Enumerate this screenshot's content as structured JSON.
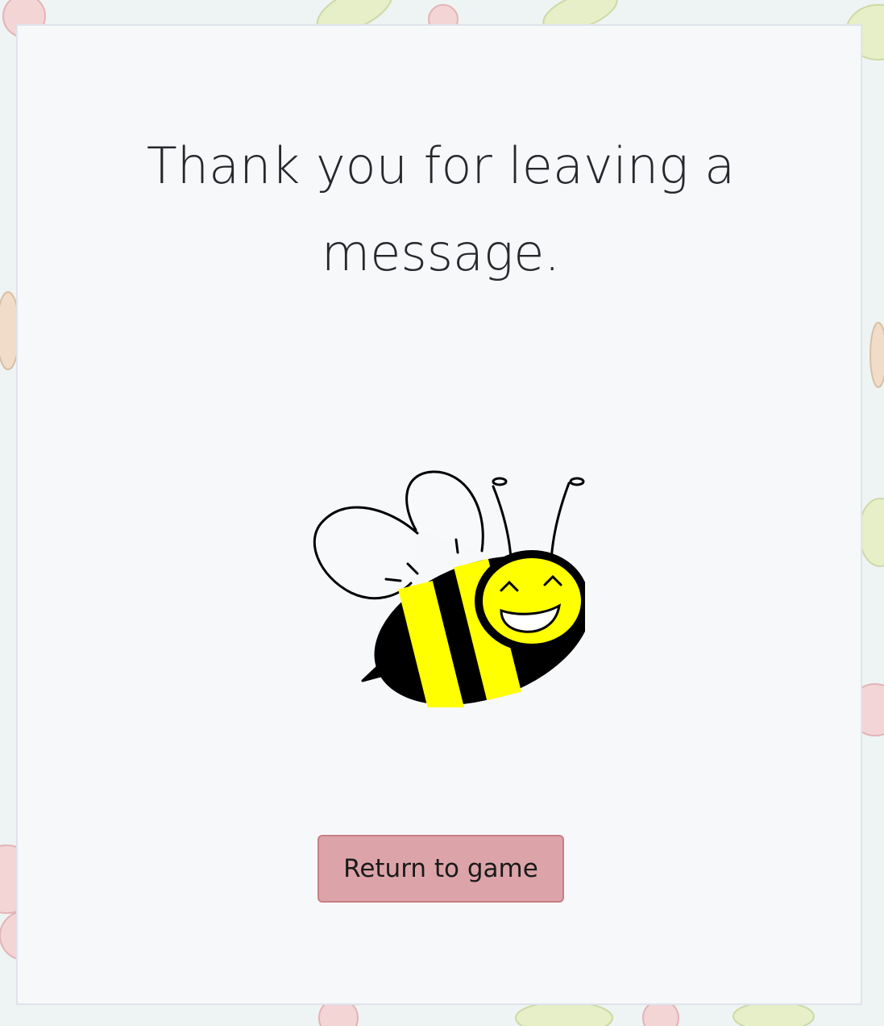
{
  "message": {
    "title": "Thank you for leaving a message."
  },
  "actions": {
    "return_label": "Return to game"
  },
  "colors": {
    "page_background": "#eef4f3",
    "card_background": "#f7f8fa",
    "card_border": "#dfe3ec",
    "button_fill": "#dca4a9",
    "button_border": "#c87e85",
    "text": "#25282c",
    "bee_yellow": "#ffff00"
  },
  "icons": {
    "mascot": "smiling-bee-icon"
  }
}
